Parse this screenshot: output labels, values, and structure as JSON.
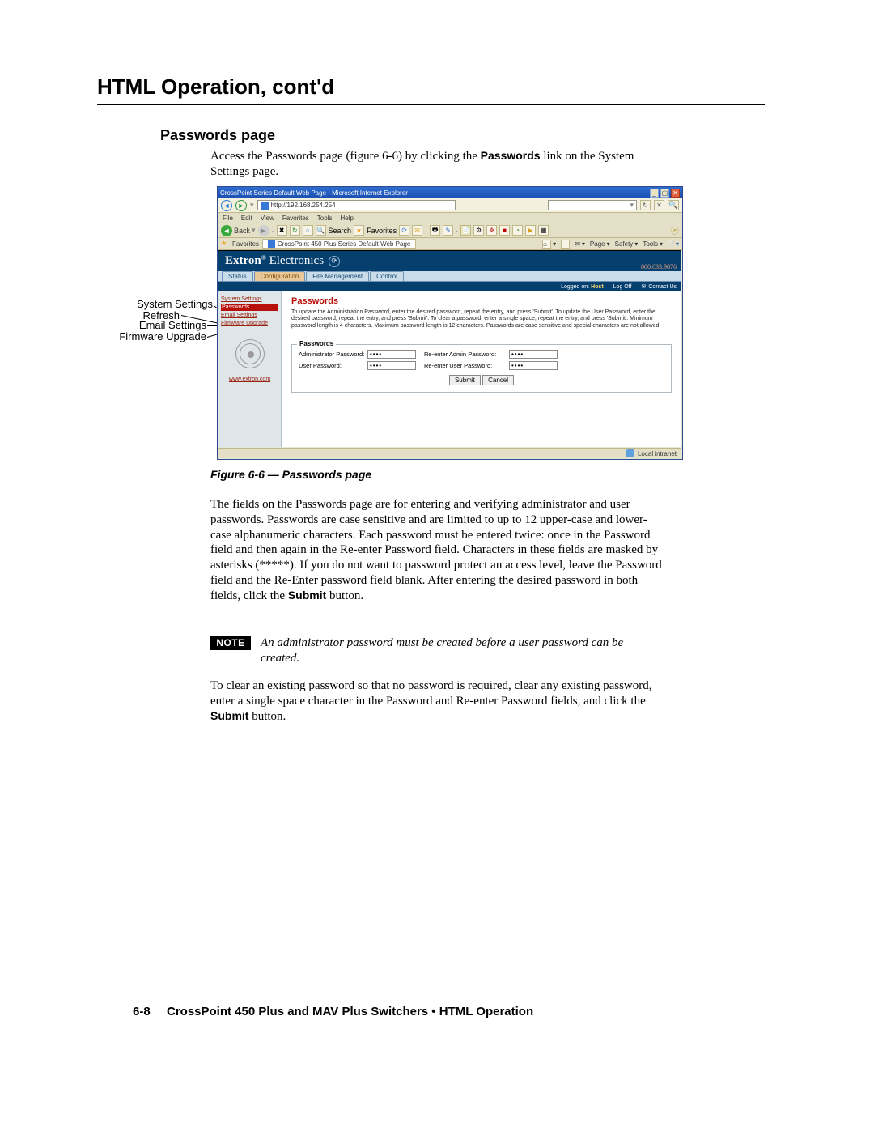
{
  "page": {
    "title": "HTML Operation, cont'd",
    "section": "Passwords page",
    "intro_pre": "Access the Passwords page (figure 6-6) by clicking the ",
    "intro_bold": "Passwords",
    "intro_post": " link on the System Settings page.",
    "figure_caption": "Figure 6-6 — Passwords page",
    "body1": "The fields on the Passwords page are for entering and verifying administrator and user passwords.  Passwords are case sensitive and are limited to up to 12 upper-case and lower-case alphanumeric characters.  Each password must be entered twice: once in the Password field and then again in the Re-enter Password field.  Characters in these fields are masked by asterisks (*****).  If you do not want to password protect an access level, leave the Password field and the Re-Enter password field blank.  After entering the desired password in both fields, click the ",
    "body1_bold": "Submit",
    "body1_post": " button.",
    "note_label": "NOTE",
    "note_text": "An administrator password must be created before a user password can be created.",
    "body2": "To clear an existing password so that no password is required, clear any existing password, enter a single space character in the Password and Re-enter Password fields, and click the ",
    "body2_bold": "Submit",
    "body2_post": " button.",
    "footer_page": "6-8",
    "footer_text": "CrossPoint 450 Plus and MAV Plus Switchers • HTML Operation"
  },
  "labels": {
    "system_settings": "System Settings",
    "refresh": "Refresh",
    "email_settings": "Email Settings",
    "firmware_upgrade": "Firmware Upgrade"
  },
  "browser": {
    "title": "CrossPoint Series Default Web Page - Microsoft Internet Explorer",
    "url": "http://192.168.254.254",
    "menus": [
      "File",
      "Edit",
      "View",
      "Favorites",
      "Tools",
      "Help"
    ],
    "back": "Back",
    "search": "Search",
    "fav": "Favorites",
    "favorites_label": "Favorites",
    "tab_title": "CrossPoint 450 Plus Series Default Web Page",
    "right_menus": [
      "Page",
      "Safety",
      "Tools"
    ],
    "status": "Local intranet"
  },
  "web": {
    "brand": "Extron",
    "brand2": "Electronics",
    "phone": "800.633.9876",
    "tabs": [
      "Status",
      "Configuration",
      "File Management",
      "Control"
    ],
    "active_tab": 1,
    "logged_label": "Logged on:",
    "logged_user": "Host",
    "logoff": "Log Off",
    "contact": "Contact Us",
    "sidebar": {
      "items": [
        "System Settings",
        "Passwords",
        "Email Settings",
        "Firmware Upgrade"
      ],
      "active": 1,
      "url": "www.extron.com"
    },
    "main": {
      "heading": "Passwords",
      "help": "To update the Administration Password, enter the desired password, repeat the entry, and press 'Submit'.  To update the User Password, enter the desired password, repeat the entry, and press 'Submit'.  To clear a password, enter a single space, repeat the entry, and press 'Submit'.  Minimum password length is 4 characters.  Maximum password length is 12 characters.  Passwords are case sensitive and special characters are not allowed.",
      "legend": "Passwords",
      "admin_label": "Administrator Password:",
      "readmin_label": "Re-enter Admin Password:",
      "user_label": "User Password:",
      "reuser_label": "Re-enter User Password:",
      "mask": "••••",
      "submit": "Submit",
      "cancel": "Cancel"
    }
  }
}
